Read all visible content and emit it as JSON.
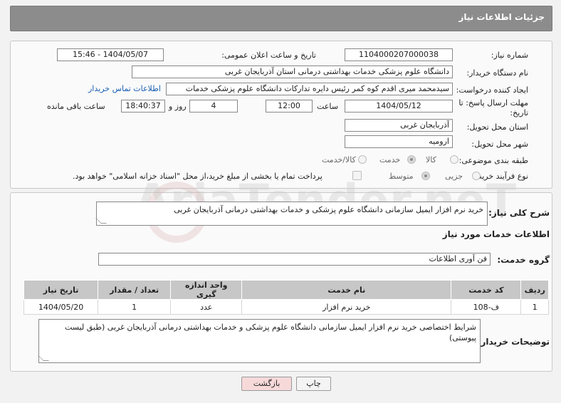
{
  "header": {
    "title": "جزئیات اطلاعات نیاز"
  },
  "need": {
    "number_label": "شماره نیاز:",
    "number": "1104000207000038",
    "announce_label": "تاریخ و ساعت اعلان عمومی:",
    "announce_value": "1404/05/07 - 15:46",
    "buyer_org_label": "نام دستگاه خریدار:",
    "buyer_org": "دانشگاه علوم پزشکی خدمات بهداشتی درمانی استان آذربایجان غربی",
    "creator_label": "ایجاد کننده درخواست:",
    "creator": "سیدمحمد میری اقدم کوه کمر رئیس دایره تدارکات دانشگاه علوم پزشکی خدمات",
    "contact_link": "اطلاعات تماس خریدار",
    "deadline_label_1": "مهلت ارسال پاسخ: تا",
    "deadline_label_2": "تاریخ:",
    "deadline_date": "1404/05/12",
    "time_label": "ساعت",
    "deadline_time": "12:00",
    "days_value": "4",
    "days_label": "روز و",
    "remaining_time": "18:40:37",
    "remaining_label": "ساعت باقی مانده",
    "province_label": "استان محل تحویل:",
    "province": "آذربایجان غربی",
    "city_label": "شهر محل تحویل:",
    "city": "ارومیه",
    "category_label": "طبقه بندی موضوعی:",
    "category_options": [
      "کالا",
      "خدمت",
      "کالا/خدمت"
    ],
    "process_label": "نوع فرآیند خرید :",
    "process_options": [
      "جزیی",
      "متوسط"
    ],
    "payment_note": "پرداخت تمام یا بخشی از مبلغ خرید،از محل \"اسناد خزانه اسلامی\" خواهد بود."
  },
  "summary": {
    "label": "شرح کلی نیاز:",
    "text": "خرید نرم افزار ایمیل سازمانی دانشگاه علوم پزشکی و خدمات بهداشتی درمانی آذربایجان غربی"
  },
  "services": {
    "section_title": "اطلاعات خدمات مورد نیاز",
    "group_label": "گروه خدمت:",
    "group_value": "فن آوری اطلاعات",
    "table": {
      "headers": [
        "ردیف",
        "کد خدمت",
        "نام خدمت",
        "واحد اندازه گیری",
        "تعداد / مقدار",
        "تاریخ نیاز"
      ],
      "rows": [
        [
          "1",
          "ف-108",
          "خرید نرم افزار",
          "عدد",
          "1",
          "1404/05/20"
        ]
      ]
    }
  },
  "buyer_notes": {
    "label": "توضیحات خریدار:",
    "text": "شرایط اختصاصی خرید نرم افزار ایمیل سازمانی دانشگاه علوم پزشکی و خدمات بهداشتی درمانی آذربایجان غربی (طبق لیست پیوستی)"
  },
  "buttons": {
    "print": "چاپ",
    "back": "بازگشت"
  },
  "watermark": {
    "text": "AriaTender.neT"
  },
  "colors": {
    "header_bg": "#8c8c8c",
    "link": "#1a5fb4",
    "table_header": "#c7c7c7",
    "back_button": "#f7d9d9"
  }
}
